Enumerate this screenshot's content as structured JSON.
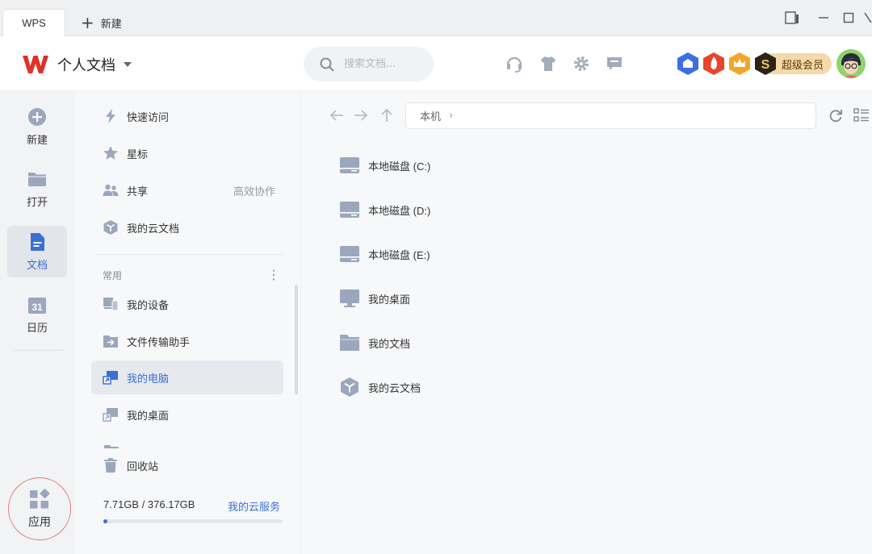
{
  "tabs": {
    "active": "WPS",
    "new_tab": "新建"
  },
  "header": {
    "title": "个人文档",
    "search_placeholder": "搜索文档...",
    "vip_label": "超级会员"
  },
  "rail": {
    "items": [
      {
        "label": "新建"
      },
      {
        "label": "打开"
      },
      {
        "label": "文档"
      },
      {
        "label": "日历"
      }
    ],
    "apps_label": "应用"
  },
  "nav": {
    "top_items": [
      {
        "label": "快速访问"
      },
      {
        "label": "星标"
      },
      {
        "label": "共享",
        "extra": "高效协作"
      },
      {
        "label": "我的云文档"
      }
    ],
    "section_title": "常用",
    "common_items": [
      {
        "label": "我的设备"
      },
      {
        "label": "文件传输助手"
      },
      {
        "label": "我的电脑"
      },
      {
        "label": "我的桌面"
      }
    ],
    "recycle": "回收站",
    "storage": "7.71GB / 376.17GB",
    "cloud_service": "我的云服务",
    "storage_used_fraction": 0.0205
  },
  "main": {
    "path": "本机",
    "items": [
      {
        "label": "本地磁盘 (C:)"
      },
      {
        "label": "本地磁盘 (D:)"
      },
      {
        "label": "本地磁盘 (E:)"
      },
      {
        "label": "我的桌面"
      },
      {
        "label": "我的文档"
      },
      {
        "label": "我的云文档"
      }
    ]
  },
  "colors": {
    "accent": "#3b6fd6",
    "icon": "#9aa7bd"
  }
}
